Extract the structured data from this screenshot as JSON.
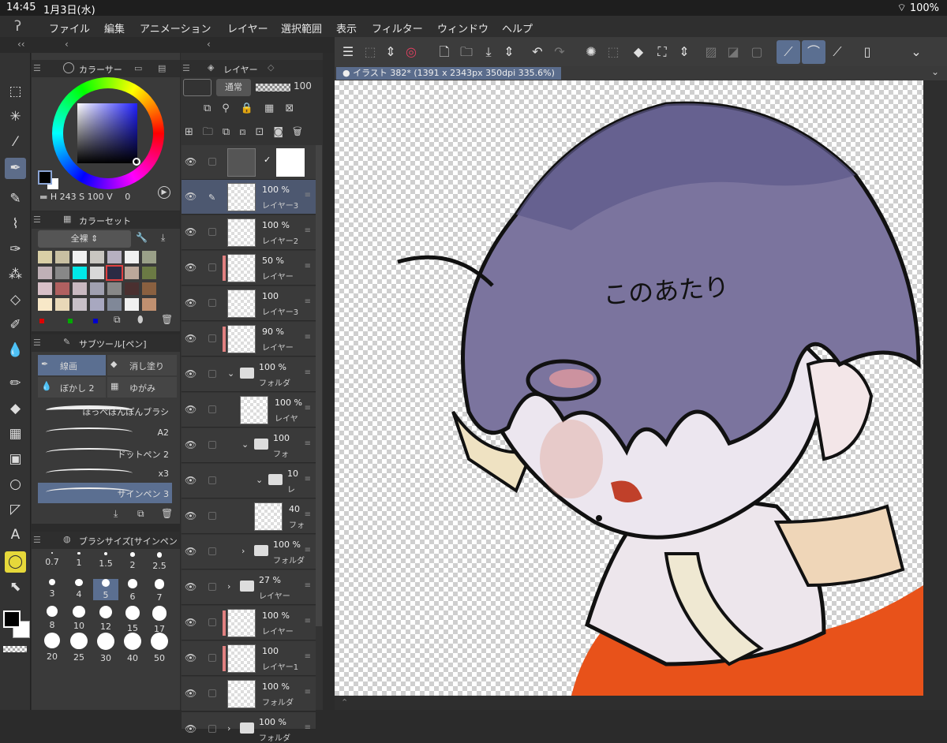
{
  "status": {
    "time": "14:45",
    "date": "1月3日(水)",
    "battery": "100%"
  },
  "menu": [
    "ファイル",
    "編集",
    "アニメーション",
    "レイヤー",
    "選択範囲",
    "表示",
    "フィルター",
    "ウィンドウ",
    "ヘルプ"
  ],
  "color_panel": {
    "title": "カラーサー",
    "h_label": "H",
    "h": "243",
    "s_label": "S",
    "s": "100",
    "v_label": "V",
    "v": "0"
  },
  "color_set": {
    "title": "カラーセット",
    "dropdown": "全裸"
  },
  "sub_tool": {
    "title": "サブツール[ペン]",
    "tabs": [
      "線画",
      "消し塗り",
      "ぼかし 2",
      "ゆがみ"
    ],
    "brushes": [
      "ほっぺぽんぽんブラシ",
      "A2",
      "ドットペン 2",
      "x3",
      "サインペン 3"
    ]
  },
  "brush_size": {
    "title": "ブラシサイズ[サインペン",
    "sizes": [
      "0.7",
      "1",
      "1.5",
      "2",
      "2.5",
      "3",
      "4",
      "5",
      "6",
      "7",
      "8",
      "10",
      "12",
      "15",
      "17",
      "20",
      "25",
      "30",
      "40",
      "50"
    ]
  },
  "layer_panel": {
    "title": "レイヤー",
    "blend": "通常",
    "opacity": "100"
  },
  "layers": [
    {
      "op": "100 %",
      "name": "レイヤー3"
    },
    {
      "op": "100 %",
      "name": "レイヤー2"
    },
    {
      "op": "50 %",
      "name": "レイヤー"
    },
    {
      "op": "100",
      "name": "レイヤー3"
    },
    {
      "op": "90 %",
      "name": "レイヤー"
    },
    {
      "op": "100 %",
      "name": "フォルダ"
    },
    {
      "op": "100 %",
      "name": "レイヤ"
    },
    {
      "op": "100",
      "name": "フォ"
    },
    {
      "op": "10",
      "name": "レ"
    },
    {
      "op": "40",
      "name": "フォ"
    },
    {
      "op": "100 %",
      "name": "フォルダ"
    },
    {
      "op": "27 %",
      "name": "レイヤー"
    },
    {
      "op": "100 %",
      "name": "レイヤー"
    },
    {
      "op": "100",
      "name": "レイヤー1"
    },
    {
      "op": "100 %",
      "name": "フォルダ"
    },
    {
      "op": "100 %",
      "name": "フォルダ"
    }
  ],
  "canvas_tab": "イラスト 382* (1391 x 2343px 350dpi 335.6%)",
  "canvas_text": "このあたり",
  "colors": {
    "accent": "#5b6f91",
    "panel": "#3a3a3a",
    "hair": "#6a6590",
    "shirt": "#e8521a"
  }
}
